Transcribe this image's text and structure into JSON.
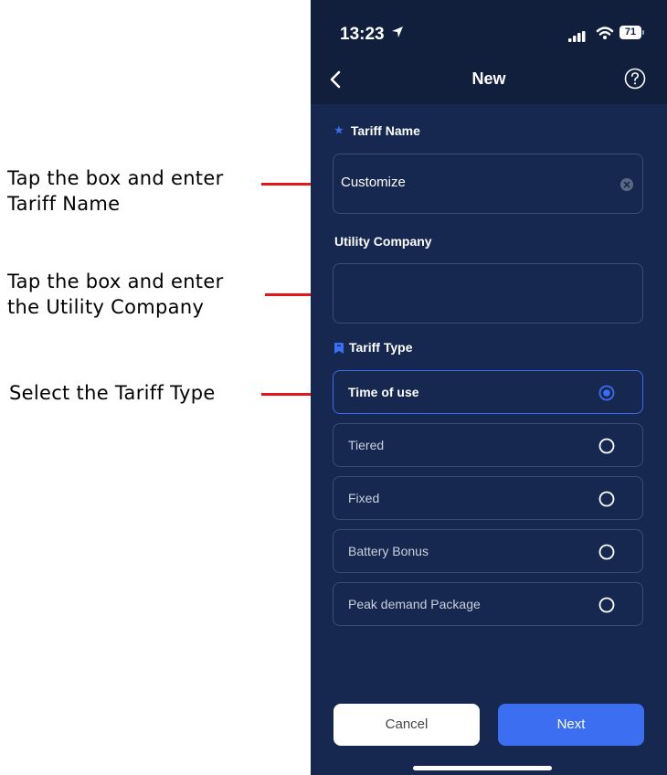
{
  "annotations": [
    {
      "lines": [
        "Tap the box and enter",
        "Tariff Name"
      ]
    },
    {
      "lines": [
        "Tap the box and enter",
        "the Utility Company"
      ]
    },
    {
      "lines": [
        "Select the Tariff Type"
      ]
    }
  ],
  "status_bar": {
    "time": "13:23",
    "battery": "71",
    "icons": [
      "location-arrow-icon",
      "signal-icon",
      "wifi-icon",
      "battery-icon"
    ]
  },
  "nav": {
    "title": "New",
    "back_icon": "chevron-left-icon",
    "help_icon": "help-circle-icon"
  },
  "form": {
    "tariff_name_label": "Tariff Name",
    "tariff_name_value": "Customize",
    "utility_company_label": "Utility Company",
    "utility_company_value": "",
    "tariff_type_label": "Tariff Type",
    "tariff_types": [
      {
        "label": "Time of use",
        "selected": true
      },
      {
        "label": "Tiered",
        "selected": false
      },
      {
        "label": "Fixed",
        "selected": false
      },
      {
        "label": "Battery Bonus",
        "selected": false
      },
      {
        "label": "Peak demand Package",
        "selected": false
      }
    ]
  },
  "buttons": {
    "cancel": "Cancel",
    "next": "Next"
  },
  "colors": {
    "background": "#16284f",
    "header": "#111f3c",
    "accent": "#3b6ef0",
    "annotation_line": "#e3161c"
  }
}
